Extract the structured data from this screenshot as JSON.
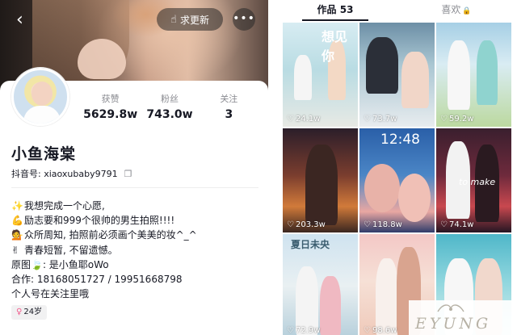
{
  "header": {
    "update_button_label": "求更新",
    "more_button_label": "•••",
    "back_glyph": "‹",
    "update_glyph": "☝"
  },
  "profile": {
    "stats": [
      {
        "label": "获赞",
        "value": "5629.8w"
      },
      {
        "label": "粉丝",
        "value": "743.0w"
      },
      {
        "label": "关注",
        "value": "3"
      }
    ],
    "nickname": "小鱼海棠",
    "douyin_id": "抖音号: xiaoxubaby9791",
    "copy_glyph": "❐",
    "bio": [
      {
        "emoji": "✨",
        "text": "我想完成一个心愿,"
      },
      {
        "emoji": "💪",
        "text": "励志要和999个很帅的男生拍照!!!!"
      },
      {
        "emoji": "💁",
        "text": "众所周知, 拍照前必须画个美美的妆^_^"
      },
      {
        "emoji": "✌",
        "text": "青春短暂, 不留遗憾。"
      },
      {
        "emoji": "",
        "text": "原图🍃: 是小鱼耶oWo"
      },
      {
        "emoji": "",
        "text": "合作: 18168051727 / 19951668798"
      },
      {
        "emoji": "",
        "text": "个人号在关注里哦"
      }
    ],
    "age_tag": "24岁",
    "age_tag_icon": "♀"
  },
  "works": {
    "tabs": [
      {
        "label": "作品 53",
        "active": true
      },
      {
        "label": "喜欢",
        "active": false,
        "icon": "🔒"
      }
    ],
    "tiles": [
      {
        "likes": "24.1w",
        "overlay": "想见你"
      },
      {
        "likes": "73.7w",
        "overlay": ""
      },
      {
        "likes": "59.2w",
        "overlay": ""
      },
      {
        "likes": "203.3w",
        "overlay": ""
      },
      {
        "likes": "118.8w",
        "overlay": "12:48"
      },
      {
        "likes": "74.1w",
        "overlay": "to make"
      },
      {
        "likes": "72.9w",
        "overlay": "夏日未央"
      },
      {
        "likes": "98.6w",
        "overlay": ""
      },
      {
        "likes": "",
        "overlay": ""
      }
    ],
    "heart_glyph": "♡"
  },
  "watermark": {
    "text": "EYUNG"
  },
  "icons": [
    "back-icon",
    "hand-pointer-icon",
    "more-icon",
    "copy-icon",
    "female-icon",
    "lock-icon",
    "heart-icon"
  ]
}
